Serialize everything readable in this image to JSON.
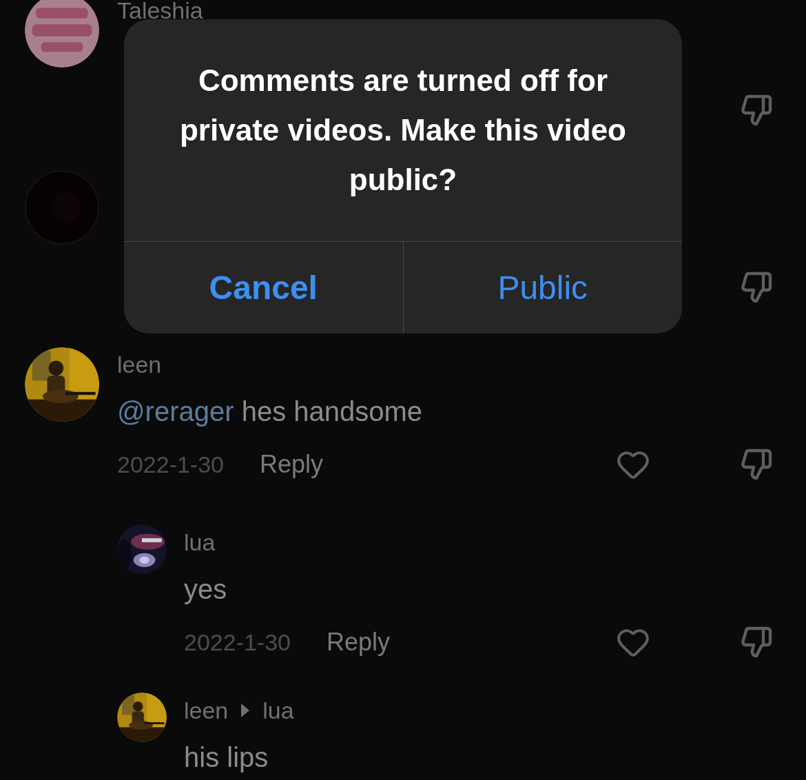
{
  "comments": [
    {
      "avatar": {
        "kind": "picture"
      },
      "username": "Taleshia"
    },
    {
      "avatar": {
        "kind": "picture"
      }
    },
    {
      "avatar": {
        "kind": "picture"
      },
      "username": "leen",
      "mention": "@rerager",
      "text": "hes handsome",
      "date": "2022-1-30",
      "reply": "Reply",
      "replies": [
        {
          "avatar": {
            "kind": "picture"
          },
          "username": "lua",
          "text": "yes",
          "date": "2022-1-30",
          "reply": "Reply"
        },
        {
          "avatar": {
            "kind": "picture"
          },
          "username": "leen",
          "reply_to": "lua",
          "text": "his lips"
        }
      ]
    }
  ],
  "dialog": {
    "message": "Comments are turned off for private videos. Make this video public?",
    "buttons": [
      {
        "label": "Cancel",
        "kind": "cancel"
      },
      {
        "label": "Public",
        "kind": "confirm"
      }
    ]
  }
}
